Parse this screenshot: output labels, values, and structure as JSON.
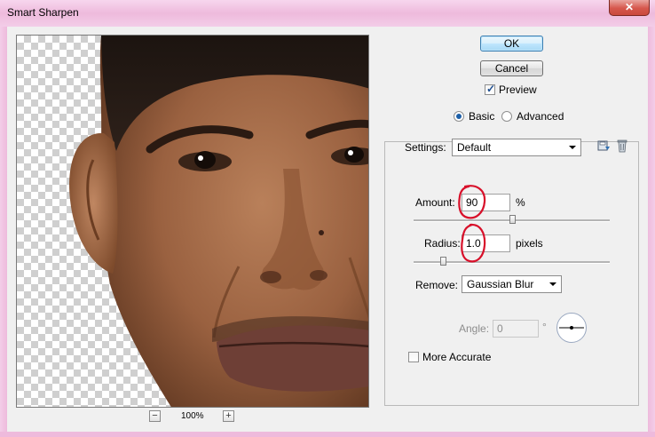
{
  "window": {
    "title": "Smart Sharpen",
    "close_glyph": "✕"
  },
  "buttons": {
    "ok": "OK",
    "cancel": "Cancel"
  },
  "preview": {
    "label": "Preview",
    "checked": true
  },
  "mode": {
    "basic": "Basic",
    "advanced": "Advanced",
    "selected": "basic"
  },
  "settings": {
    "label": "Settings:",
    "value": "Default"
  },
  "amount": {
    "label": "Amount:",
    "value": "90",
    "unit": "%",
    "slider_fraction": 0.5
  },
  "radius": {
    "label": "Radius:",
    "value": "1.0",
    "unit": "pixels",
    "slider_fraction": 0.15
  },
  "remove": {
    "label": "Remove:",
    "value": "Gaussian Blur"
  },
  "angle": {
    "label": "Angle:",
    "value": "0",
    "unit": "°"
  },
  "more_accurate": {
    "label": "More Accurate",
    "checked": false
  },
  "zoom": {
    "level": "100%",
    "minus": "−",
    "plus": "+"
  },
  "icons": {
    "save": "save-settings-icon",
    "delete": "delete-settings-icon"
  },
  "colors": {
    "annotation": "#d8102a",
    "default_button_border": "#3c7fb1",
    "titlebar": "#eebadc"
  }
}
